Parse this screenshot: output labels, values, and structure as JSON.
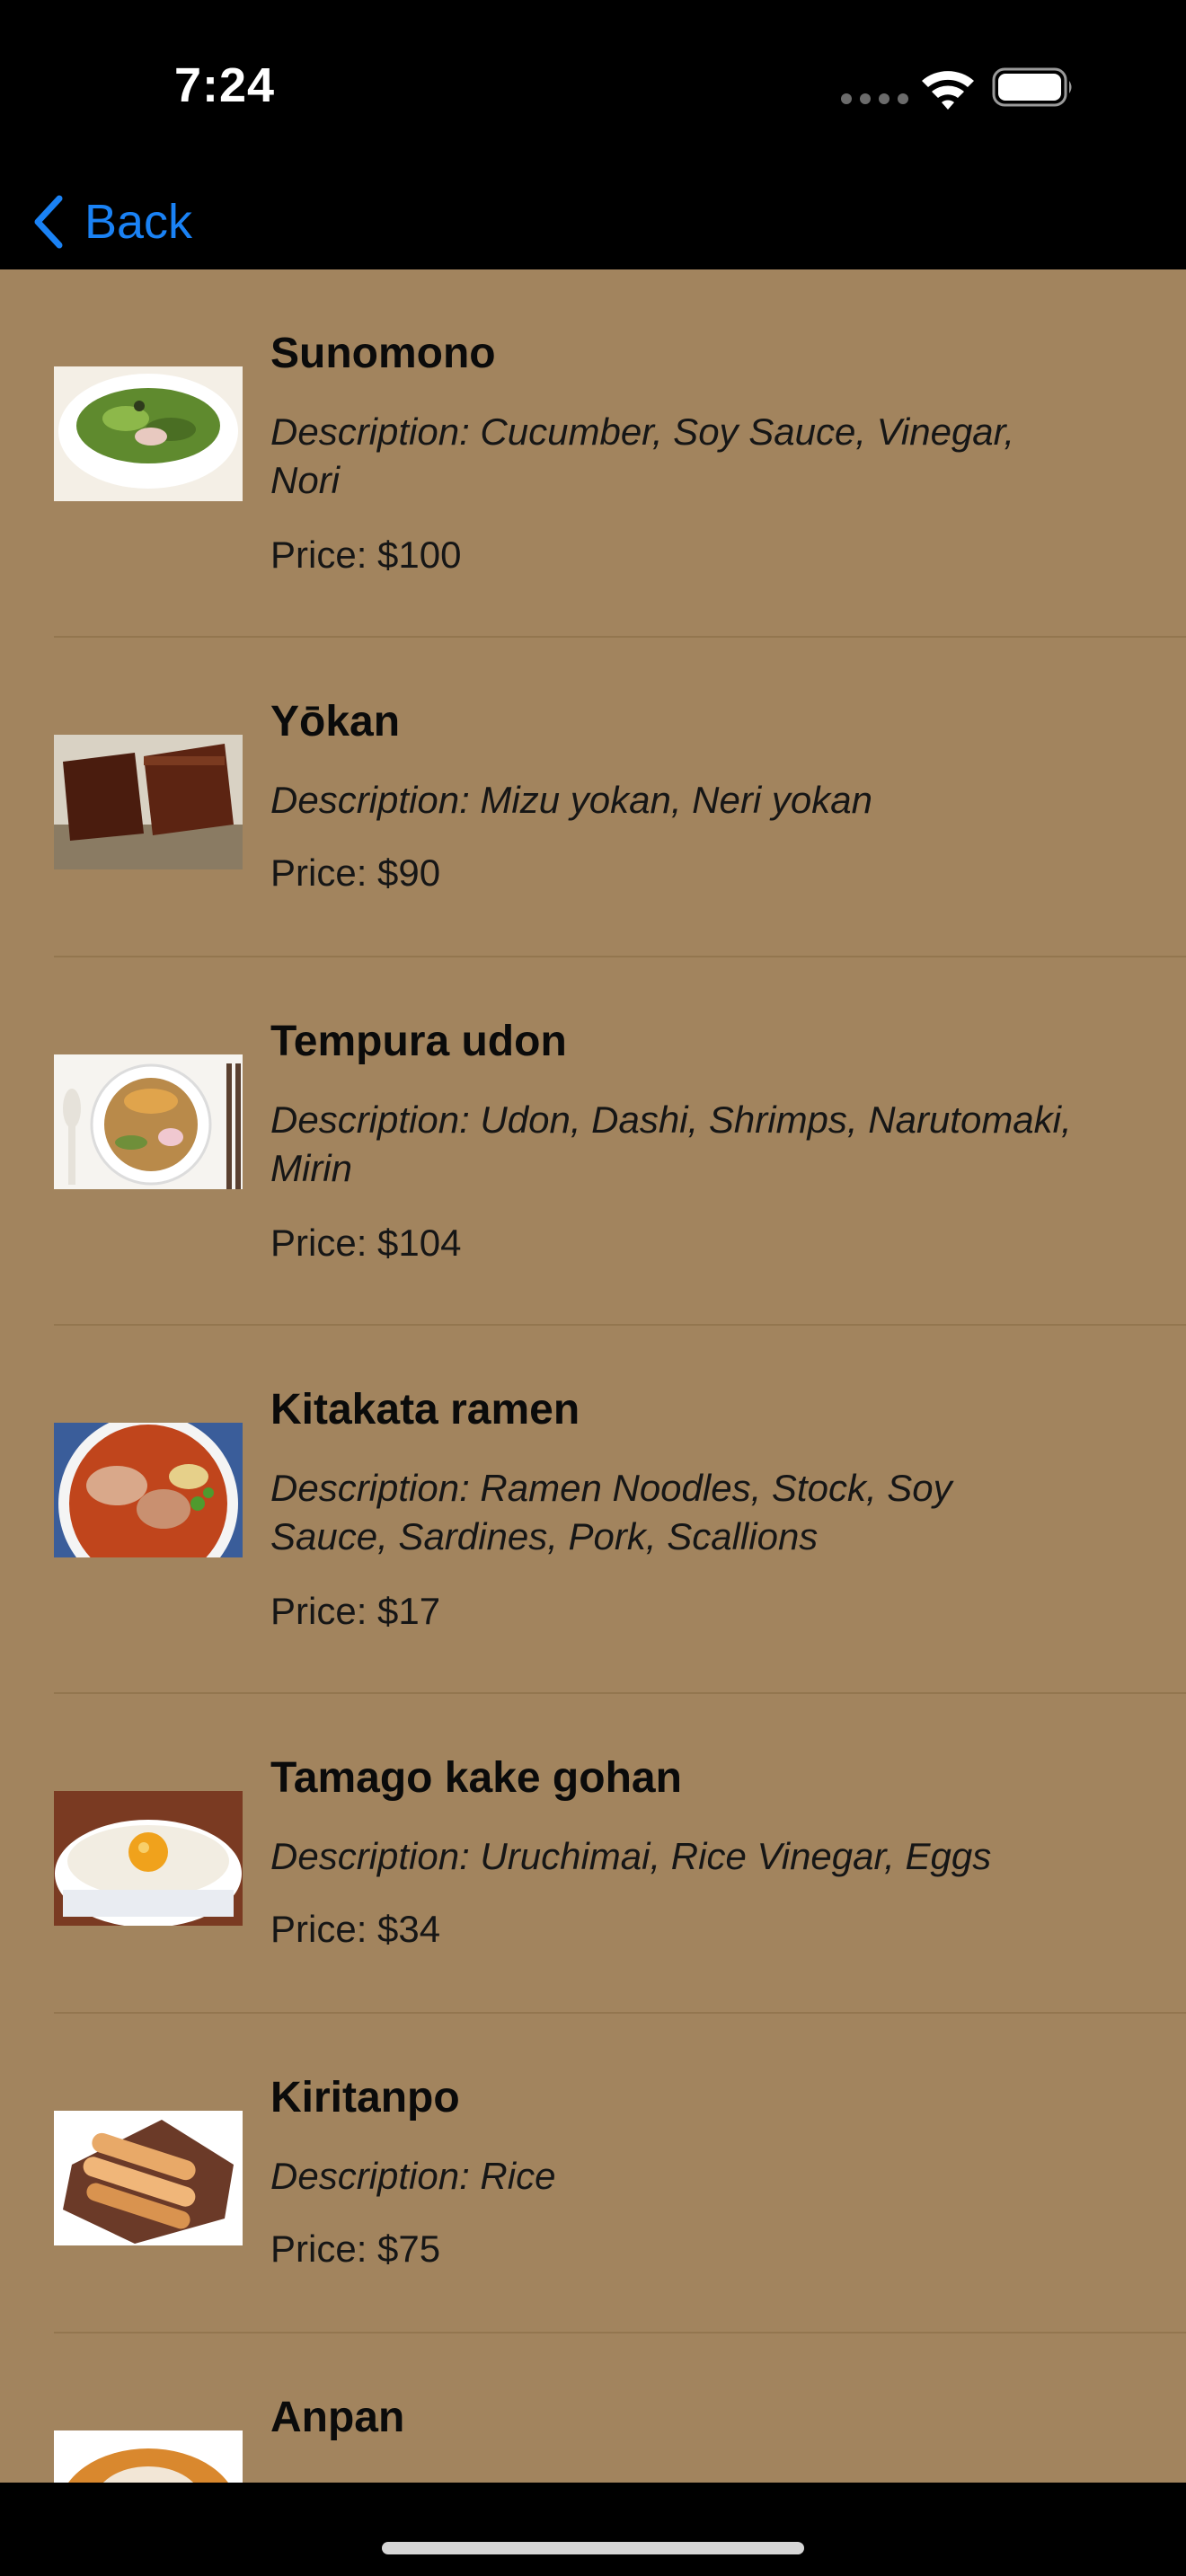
{
  "status_bar": {
    "time": "7:24",
    "icons": [
      "signal-dots-icon",
      "wifi-icon",
      "battery-icon"
    ]
  },
  "nav": {
    "back_label": "Back",
    "back_icon": "chevron-left-icon",
    "accent_color": "#1a82f5"
  },
  "list_background": "#a2845e",
  "dishes": [
    {
      "name": "Sunomono",
      "description": "Description: Cucumber, Soy Sauce, Vinegar, Nori",
      "price": "Price: $100",
      "image": "sunomono-photo"
    },
    {
      "name": "Yōkan",
      "description": "Description: Mizu yokan, Neri yokan",
      "price": "Price: $90",
      "image": "yokan-photo"
    },
    {
      "name": "Tempura udon",
      "description": "Description: Udon, Dashi, Shrimps, Narutomaki, Mirin",
      "price": "Price: $104",
      "image": "tempura-udon-photo"
    },
    {
      "name": "Kitakata ramen",
      "description": "Description: Ramen Noodles, Stock, Soy Sauce, Sardines, Pork, Scallions",
      "price": "Price: $17",
      "image": "kitakata-ramen-photo"
    },
    {
      "name": "Tamago kake gohan",
      "description": "Description: Uruchimai, Rice Vinegar, Eggs",
      "price": "Price: $34",
      "image": "tamago-kake-gohan-photo"
    },
    {
      "name": "Kiritanpo",
      "description": "Description: Rice",
      "price": "Price: $75",
      "image": "kiritanpo-photo"
    },
    {
      "name": "Anpan",
      "image": "anpan-photo"
    }
  ]
}
